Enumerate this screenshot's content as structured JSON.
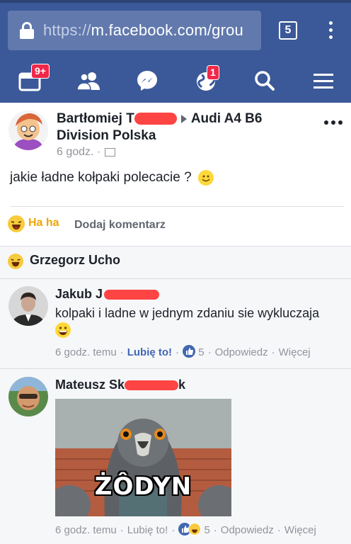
{
  "browser": {
    "url_scheme": "https://",
    "url_host": "m.facebook.com/grou",
    "tab_count": "5"
  },
  "nav": {
    "notifications_badge": "9+",
    "globe_badge": "1",
    "icons": [
      "news-feed-icon",
      "friends-icon",
      "messenger-icon",
      "globe-icon",
      "search-icon",
      "menu-icon"
    ]
  },
  "post": {
    "author_first": "Bartłomiej",
    "author_redacted": "T",
    "group_name": "Audi A4 B6 Division Polska",
    "time": "6 godz. ·",
    "text": "jakie ładne kołpaki polecacie ?",
    "reaction_label": "Ha ha",
    "comment_action": "Dodaj komentarz"
  },
  "reactor": {
    "name": "Grzegorz Ucho"
  },
  "comments": [
    {
      "author_first": "Jakub J",
      "text": "kolpaki i ladne w jednym zdaniu sie wykluczaja",
      "time": "6 godz. temu",
      "like_label": "Lubię to!",
      "reaction_count": "5",
      "reply_label": "Odpowiedz",
      "more_label": "Więcej"
    },
    {
      "author_first": "Mateusz Sk",
      "author_last_visible": "k",
      "image_caption": "ŻÔDYN",
      "time": "6 godz. temu",
      "like_label": "Lubię to!",
      "reaction_count": "5",
      "reply_label": "Odpowiedz",
      "more_label": "Więcej"
    }
  ],
  "colors": {
    "brand": "#3b5998",
    "like": "#4267b2",
    "haha": "#f0a500",
    "redaction": "#f44444"
  }
}
